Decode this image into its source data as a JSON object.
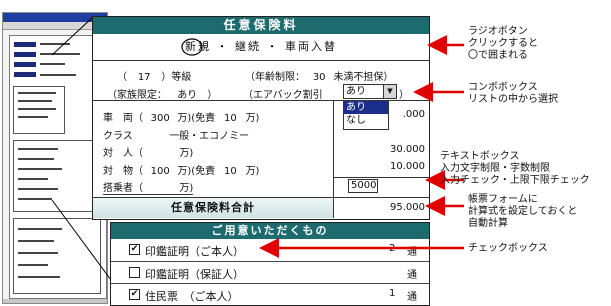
{
  "form": {
    "title": "任意保険料",
    "radio_row": {
      "options": [
        "新規",
        "継続",
        "車両入替"
      ],
      "separator": "・"
    },
    "grade": {
      "prefix": "（",
      "value": "17",
      "suffix": "）等級"
    },
    "age_limit": {
      "label": "（年齢制限：",
      "value": "30",
      "suffix": "未満不担保）"
    },
    "family_limit": {
      "label": "（家族限定：",
      "value": "あり",
      "suffix": "）"
    },
    "airbag": {
      "label": "（エアバック割引",
      "selected": "あり",
      "suffix": "）",
      "options": [
        "あり",
        "なし"
      ]
    },
    "vehicle": {
      "label": "車　両（",
      "value": "300",
      "unit": "万)(免責",
      "deductible": "10",
      "deductible_unit": "万)"
    },
    "class": {
      "label": "クラス",
      "value": "一般・エコノミー"
    },
    "bodily": {
      "label": "対　人（",
      "unit": "万)"
    },
    "property": {
      "label": "対　物（",
      "value": "100",
      "unit": "万)(免責",
      "deductible": "10",
      "deductible_unit": "万)"
    },
    "passenger": {
      "label": "搭乗者（",
      "unit": "万)",
      "input_value": "5000"
    },
    "amounts": [
      ".000",
      "30.000",
      "10.000"
    ],
    "total": {
      "label": "任意保険料合計",
      "value": "95.000"
    }
  },
  "checklist": {
    "title": "ご用意いただくもの",
    "items": [
      {
        "checked": true,
        "label": "印鑑証明（ご本人）",
        "count": "2",
        "unit": "通"
      },
      {
        "checked": false,
        "label": "印鑑証明（保証人）",
        "count": "",
        "unit": "通"
      },
      {
        "checked": true,
        "label": "住民票　（ご本人）",
        "count": "1",
        "unit": "通"
      }
    ]
  },
  "annotations": {
    "radio": [
      "ラジオボタン",
      "クリックすると",
      "〇で囲まれる"
    ],
    "combo": [
      "コンボボックス",
      "リストの中から選択"
    ],
    "textbox": [
      "テキストボックス",
      "入力文字制限・字数制限",
      "入力チェック・上限下限チェック"
    ],
    "calc": [
      "帳票フォームに",
      "計算式を設定しておくと",
      "自動計算"
    ],
    "checkbox": [
      "チェックボックス"
    ]
  },
  "colors": {
    "header": "#1e6b6f",
    "arrow": "#e00000",
    "selection": "#1b2e8c"
  }
}
